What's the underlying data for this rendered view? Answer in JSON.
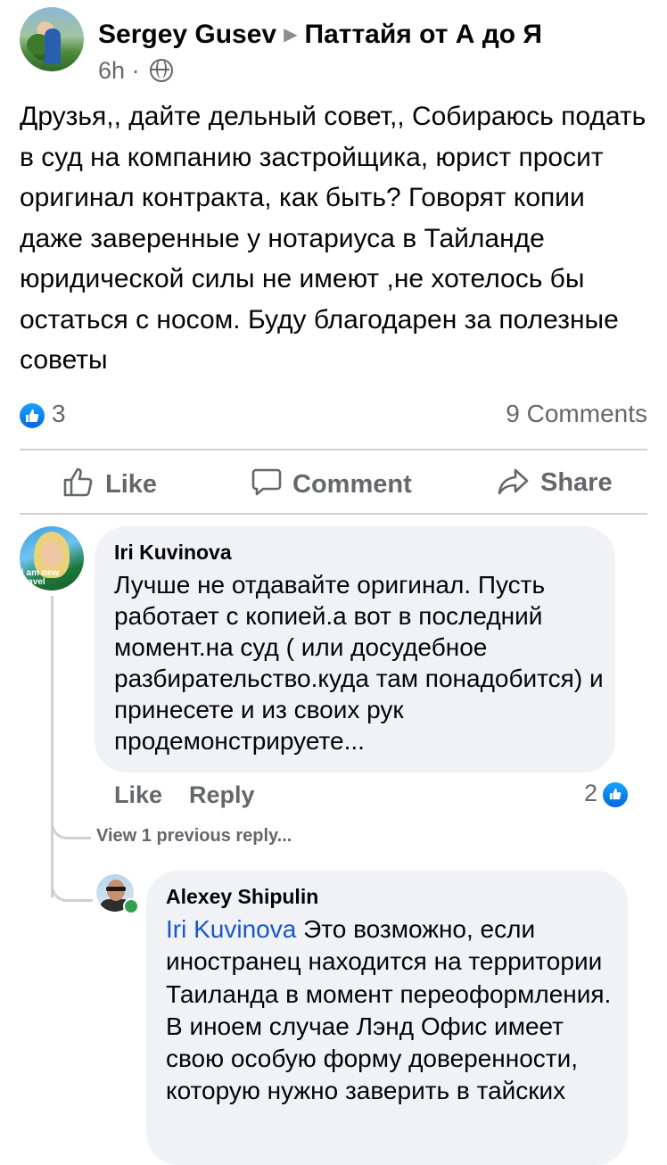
{
  "post": {
    "author": "Sergey  Gusev",
    "group": "Паттайя от А до Я",
    "time": "6h",
    "separator": "·",
    "privacy_icon": "globe-icon",
    "text": "Друзья,, дайте дельный совет,, Собираюсь подать в суд на компанию застройщика, юрист просит оригинал контракта, как быть? Говорят копии даже заверенные у нотариуса в Тайланде юридической силы не имеют ,не хотелось бы остаться с носом. Буду благодарен за полезные советы",
    "reactions_count": "3",
    "comments_count": "9 Comments"
  },
  "actions": {
    "like": "Like",
    "comment": "Comment",
    "share": "Share"
  },
  "comments": [
    {
      "author": "Iri  Kuvinova",
      "avatar_text": "i am new travel",
      "text": "Лучше не отдавайте оригинал. Пусть работает с копией.а вот в последний момент.на суд ( или досудебное разбирательство.куда там понадобится) и принесете и из своих рук продемонстрируете...",
      "like_label": "Like",
      "reply_label": "Reply",
      "reactions_count": "2"
    }
  ],
  "view_previous": "View 1 previous reply...",
  "reply": {
    "author": "Alexey Shipulin",
    "mention": "Iri  Kuvinova",
    "text": " Это возможно, если иностранец находится на территории Таиланда в момент переоформления. В иноем случае Лэнд Офис имеет свою особую форму доверенности, которую нужно заверить в тайских"
  },
  "colors": {
    "facebook_blue": "#0866ff",
    "mention_blue": "#1b56c7",
    "secondary_text": "#65676b",
    "bubble_bg": "#f0f2f5",
    "online_green": "#31a24c"
  }
}
